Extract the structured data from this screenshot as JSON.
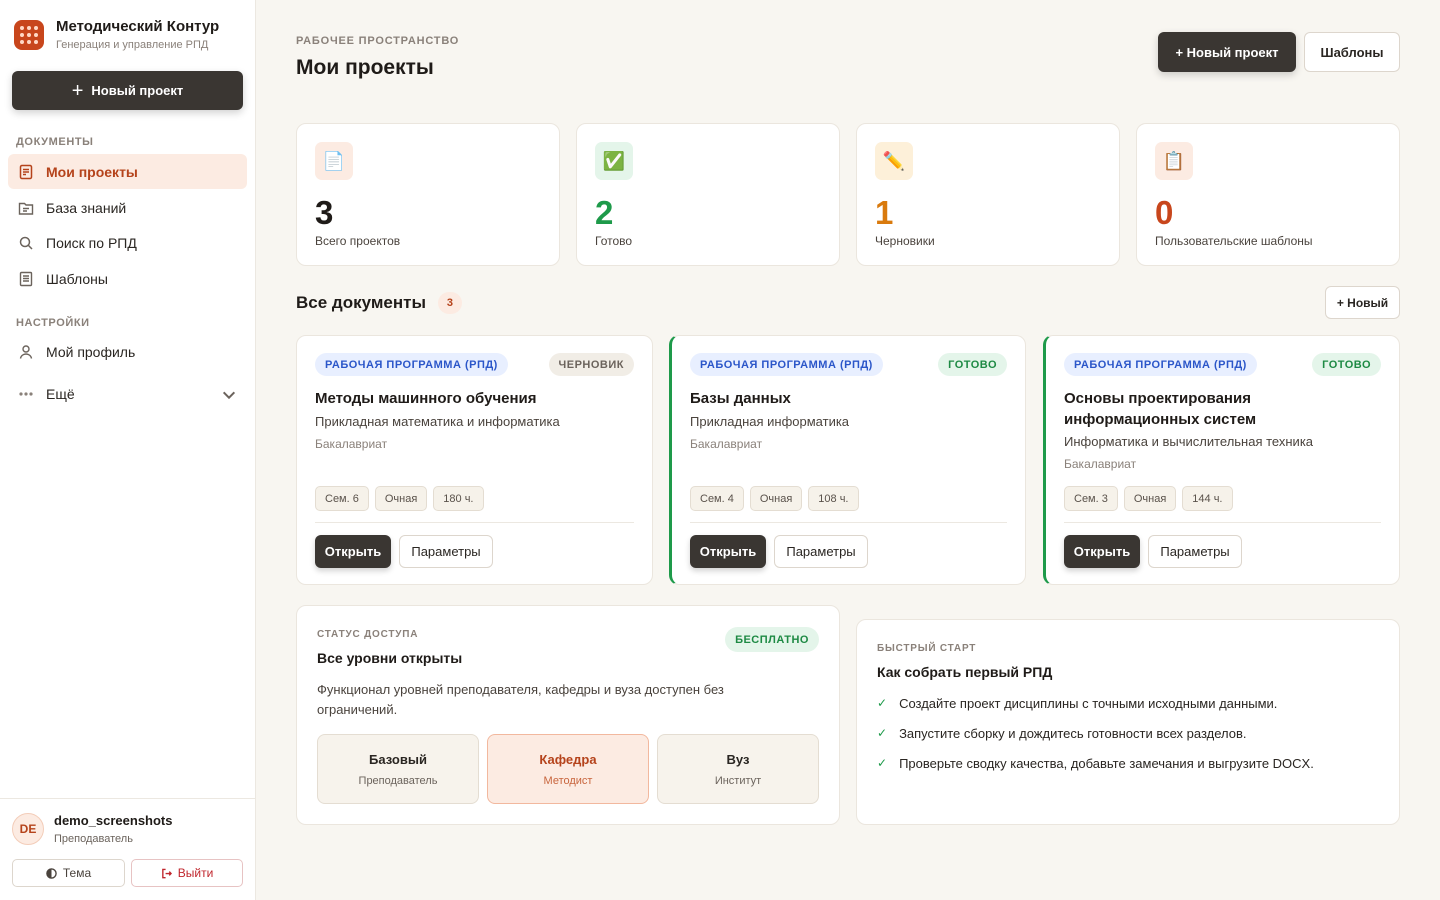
{
  "app": {
    "name": "Методический Контур",
    "tagline": "Генерация и управление РПД"
  },
  "sidebar": {
    "new_project": "Новый проект",
    "sections": [
      {
        "label": "ДОКУМЕНТЫ",
        "items": [
          {
            "label": "Мои проекты",
            "icon": "document-icon",
            "active": true
          },
          {
            "label": "База знаний",
            "icon": "folder-icon"
          },
          {
            "label": "Поиск по РПД",
            "icon": "search-icon"
          },
          {
            "label": "Шаблоны",
            "icon": "template-icon"
          }
        ]
      },
      {
        "label": "НАСТРОЙКИ",
        "items": [
          {
            "label": "Мой профиль",
            "icon": "user-icon"
          },
          {
            "label": "Ещё",
            "icon": "more-icon"
          }
        ]
      }
    ],
    "user": {
      "initials": "DE",
      "name": "demo_screenshots",
      "role": "Преподаватель"
    },
    "theme_label": "Тема",
    "logout_label": "Выйти"
  },
  "header": {
    "eyebrow": "РАБОЧЕЕ ПРОСТРАНСТВО",
    "title": "Мои проекты",
    "new_project": "+ Новый проект",
    "templates": "Шаблоны"
  },
  "stats": [
    {
      "icon": "page-icon",
      "glyph": "📄",
      "value": "3",
      "label": "Всего проектов",
      "color": "#1f1b18"
    },
    {
      "icon": "check-icon",
      "glyph": "✅",
      "value": "2",
      "label": "Готово",
      "color": "#1e9a4a"
    },
    {
      "icon": "pencil-icon",
      "glyph": "✏️",
      "value": "1",
      "label": "Черновики",
      "color": "#d97a0d"
    },
    {
      "icon": "clipboard-icon",
      "glyph": "📋",
      "value": "0",
      "label": "Пользовательские шаблоны",
      "color": "#c8461c"
    }
  ],
  "documents": {
    "title": "Все документы",
    "count": "3",
    "new_label": "+ Новый",
    "items": [
      {
        "type": "РАБОЧАЯ ПРОГРАММА (РПД)",
        "status": "ЧЕРНОВИК",
        "title": "Методы машинного обучения",
        "subtitle": "Прикладная математика и информатика",
        "level": "Бакалавриат",
        "chips": [
          "Сем. 6",
          "Очная",
          "180 ч."
        ],
        "open": "Открыть",
        "params": "Параметры"
      },
      {
        "type": "РАБОЧАЯ ПРОГРАММА (РПД)",
        "status": "ГОТОВО",
        "title": "Базы данных",
        "subtitle": "Прикладная информатика",
        "level": "Бакалавриат",
        "chips": [
          "Сем. 4",
          "Очная",
          "108 ч."
        ],
        "open": "Открыть",
        "params": "Параметры"
      },
      {
        "type": "РАБОЧАЯ ПРОГРАММА (РПД)",
        "status": "ГОТОВО",
        "title": "Основы проектирования информационных систем",
        "subtitle": "Информатика и вычислительная техника",
        "level": "Бакалавриат",
        "chips": [
          "Сем. 3",
          "Очная",
          "144 ч."
        ],
        "open": "Открыть",
        "params": "Параметры"
      }
    ]
  },
  "access": {
    "eyebrow": "СТАТУС ДОСТУПА",
    "title": "Все уровни открыты",
    "badge": "БЕСПЛАТНО",
    "description": "Функционал уровней преподавателя, кафедры и вуза доступен без ограничений.",
    "tiers": [
      {
        "name": "Базовый",
        "sub": "Преподаватель"
      },
      {
        "name": "Кафедра",
        "sub": "Методист"
      },
      {
        "name": "Вуз",
        "sub": "Институт"
      }
    ]
  },
  "quickstart": {
    "eyebrow": "БЫСТРЫЙ СТАРТ",
    "title": "Как собрать первый РПД",
    "steps": [
      "Создайте проект дисциплины с точными исходными данными.",
      "Запустите сборку и дождитесь готовности всех разделов.",
      "Проверьте сводку качества, добавьте замечания и выгрузите DOCX."
    ]
  }
}
